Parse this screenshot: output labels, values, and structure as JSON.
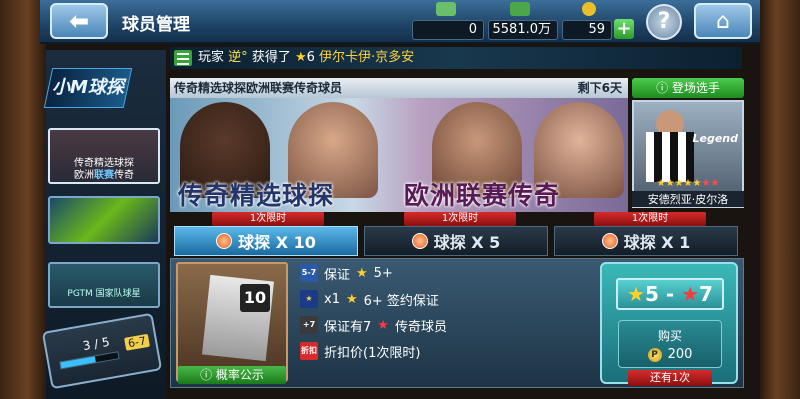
{
  "header": {
    "title": "球员管理",
    "resources": [
      {
        "icon": "match-tickets-icon",
        "value": "0"
      },
      {
        "icon": "cash-icon",
        "value": "5581.0万"
      },
      {
        "icon": "points-coin-icon",
        "value": "59"
      }
    ],
    "help_label": "?"
  },
  "ticker": {
    "prefix": "玩家",
    "player": "逆°",
    "verb": "获得了",
    "stars": "6",
    "item": "伊尔卡伊·京多安"
  },
  "left_nav": {
    "logo_label": "小M球探",
    "thumb1_line1": "传奇精选球探",
    "thumb1_line2a": "欧洲",
    "thumb1_line2b": "联赛",
    "thumb1_line2c": "传奇",
    "thumb3_caption": "PGTM 国家队球星",
    "progress_text": "3 / 5",
    "progress_value": 0.6,
    "progress_tag": "6-7"
  },
  "banner": {
    "heading": "传奇精选球探欧洲联赛传奇球员",
    "remaining": "剩下6天",
    "title_left": "传奇精选球探",
    "title_right": "欧洲联赛传奇"
  },
  "featured": {
    "button": "登场选手",
    "legend": "Legend",
    "stars": "★★★★★",
    "red_stars": "★★",
    "name": "安德烈亚·皮尔洛"
  },
  "tabs": [
    {
      "tag": "1次限时",
      "label": "球探 X 10"
    },
    {
      "tag": "1次限时",
      "label": "球探 X 5"
    },
    {
      "tag": "1次限时",
      "label": "球探 X 1"
    }
  ],
  "pack": {
    "number": "10",
    "odds_label": "概率公示"
  },
  "rules": [
    {
      "icon": "5-7",
      "text": "保证",
      "stars": "★",
      "suffix": "5+"
    },
    {
      "icon": "★",
      "text": "x1",
      "stars": "★",
      "suffix": "6+ 签约保证"
    },
    {
      "icon": "+7",
      "text": "保证有7",
      "stars": "★",
      "suffix": "传奇球员"
    },
    {
      "icon": "折扣",
      "text": "折扣价(1次限时)",
      "stars": "",
      "suffix": ""
    }
  ],
  "purchase": {
    "range_low": "5",
    "range_high": "7",
    "buy_label": "购买",
    "price": "200",
    "remaining": "还有1次"
  },
  "colors": {
    "accent": "#1a6aa0",
    "green": "#2c9a2c",
    "red": "#d82a2a",
    "gold": "#ffcf2a"
  }
}
